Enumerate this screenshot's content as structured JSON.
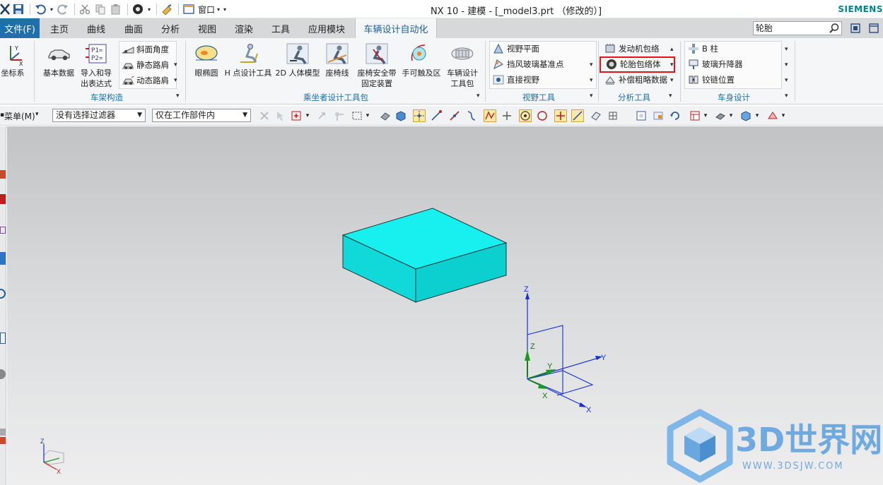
{
  "titlebar": {
    "title": "NX 10 - 建模 - [_model3.prt （修改的）]",
    "brand": "SIEMENS",
    "window_menu": "窗口"
  },
  "tabs": {
    "file": "文件(F)",
    "items": [
      "主页",
      "曲线",
      "曲面",
      "分析",
      "视图",
      "渲染",
      "工具",
      "应用模块",
      "车辆设计自动化"
    ],
    "active": "车辆设计自动化"
  },
  "search": {
    "value": "轮胎"
  },
  "ribbon": {
    "coord": {
      "label": "坐标系"
    },
    "chassis": {
      "basic_data": "基本数据",
      "import_export_1": "导入和导",
      "import_export_2": "出表达式",
      "ramp_angle": "斜面角度",
      "static_road_shoulder": "静态路肩",
      "dynamic_road_shoulder": "动态路肩",
      "group_label": "车架构造"
    },
    "occupant": {
      "eyellipse": "眼椭圆",
      "h_point": "H 点设计工具",
      "human_2d": "2D 人体模型",
      "seat_line": "座椅线",
      "seatbelt_1": "座椅安全带",
      "seatbelt_2": "固定装置",
      "hand_reach": "手可触及区",
      "vehicle_pack_1": "车辆设计",
      "vehicle_pack_2": "工具包",
      "group_label": "乘坐者设计工具包"
    },
    "view_tools": {
      "view_plane": "视野平面",
      "windshield_ref": "挡风玻璃基准点",
      "direct_vision": "直接视野",
      "group_label": "视野工具"
    },
    "analysis": {
      "engine_envelope": "发动机包络",
      "tire_envelope": "轮胎包络体",
      "compensation_data": "补偿粗略数据",
      "group_label": "分析工具"
    },
    "body": {
      "b_pillar": "B 柱",
      "window_regulator": "玻璃升降器",
      "hinge_position": "铰链位置",
      "group_label": "车身设计"
    }
  },
  "selection_bar": {
    "menu": "菜单(M)",
    "filter": "没有选择过滤器",
    "scope": "仅在工作部件内"
  },
  "viewport": {
    "axis_labels": {
      "x": "X",
      "y": "Y",
      "z": "Z"
    },
    "watermark_title": "3D世界网",
    "watermark_url": "WWW.3DSJW.COM",
    "colors": {
      "solid_top": "#18efef",
      "solid_left": "#12d9d9",
      "solid_front": "#0ccfcf",
      "highlight_box": "#e8131a"
    }
  }
}
